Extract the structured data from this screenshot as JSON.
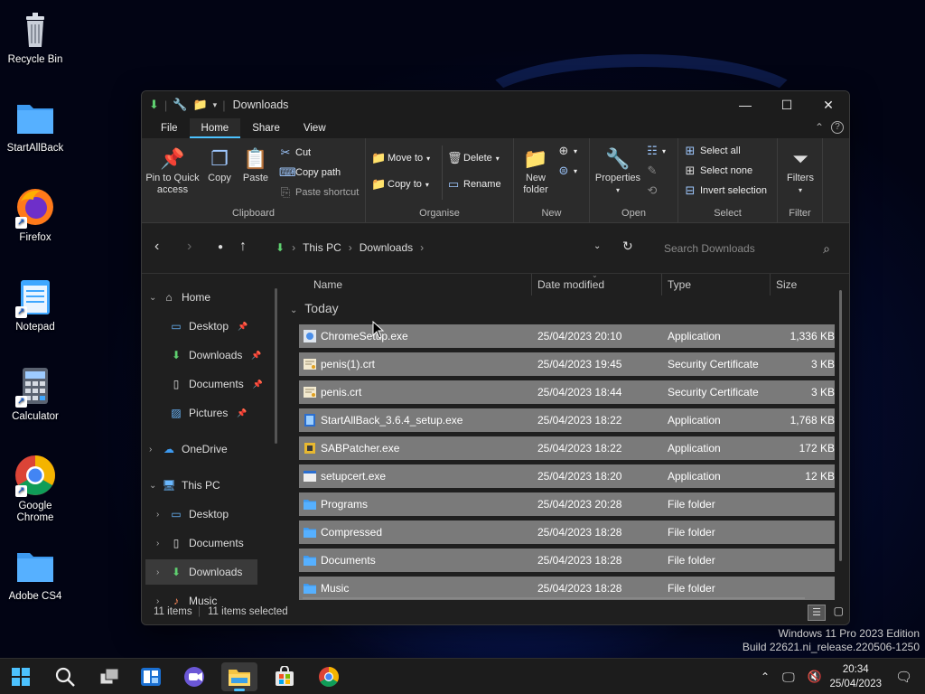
{
  "desktop_icons": [
    {
      "label": "Recycle Bin",
      "icon": "recycle-bin-icon"
    },
    {
      "label": "StartAllBack",
      "icon": "folder-icon"
    },
    {
      "label": "Firefox",
      "icon": "firefox-icon"
    },
    {
      "label": "Notepad",
      "icon": "notepad-icon"
    },
    {
      "label": "Calculator",
      "icon": "calculator-icon"
    },
    {
      "label": "Google Chrome",
      "icon": "chrome-icon"
    },
    {
      "label": "Adobe CS4",
      "icon": "folder-icon"
    }
  ],
  "window": {
    "title": "Downloads",
    "menu_tabs": [
      "File",
      "Home",
      "Share",
      "View"
    ],
    "active_tab": "Home",
    "ribbon": {
      "clipboard": {
        "name": "Clipboard",
        "pin_label": "Pin to Quick access",
        "copy_label": "Copy",
        "paste_label": "Paste",
        "cut_label": "Cut",
        "copy_path_label": "Copy path",
        "paste_shortcut_label": "Paste shortcut"
      },
      "organise": {
        "name": "Organise",
        "move_to_label": "Move to",
        "copy_to_label": "Copy to",
        "delete_label": "Delete",
        "rename_label": "Rename"
      },
      "new": {
        "name": "New",
        "new_folder_label": "New folder"
      },
      "open": {
        "name": "Open",
        "properties_label": "Properties"
      },
      "select": {
        "name": "Select",
        "select_all_label": "Select all",
        "select_none_label": "Select none",
        "invert_label": "Invert selection"
      },
      "filter": {
        "name": "Filter",
        "filters_label": "Filters"
      }
    },
    "address": {
      "crumbs": [
        "This PC",
        "Downloads"
      ],
      "search_placeholder": "Search Downloads"
    },
    "nav_pane": [
      {
        "label": "Home",
        "level": 0,
        "expanded": true
      },
      {
        "label": "Desktop",
        "level": 1,
        "pinned": true
      },
      {
        "label": "Downloads",
        "level": 1,
        "pinned": true
      },
      {
        "label": "Documents",
        "level": 1,
        "pinned": true
      },
      {
        "label": "Pictures",
        "level": 1,
        "pinned": true
      },
      {
        "label": "OneDrive",
        "level": 0,
        "expanded": false
      },
      {
        "label": "This PC",
        "level": 0,
        "expanded": true
      },
      {
        "label": "Desktop",
        "level": 1
      },
      {
        "label": "Documents",
        "level": 1
      },
      {
        "label": "Downloads",
        "level": 1,
        "selected": true
      },
      {
        "label": "Music",
        "level": 1
      }
    ],
    "columns": {
      "name": "Name",
      "date": "Date modified",
      "type": "Type",
      "size": "Size"
    },
    "group_label": "Today",
    "files": [
      {
        "name": "ChromeSetup.exe",
        "date": "25/04/2023 20:10",
        "type": "Application",
        "size": "1,336 KB",
        "icon": "setup-icon"
      },
      {
        "name": "penis(1).crt",
        "date": "25/04/2023 19:45",
        "type": "Security Certificate",
        "size": "3 KB",
        "icon": "certificate-icon"
      },
      {
        "name": "penis.crt",
        "date": "25/04/2023 18:44",
        "type": "Security Certificate",
        "size": "3 KB",
        "icon": "certificate-icon"
      },
      {
        "name": "StartAllBack_3.6.4_setup.exe",
        "date": "25/04/2023 18:22",
        "type": "Application",
        "size": "1,768 KB",
        "icon": "app-icon"
      },
      {
        "name": "SABPatcher.exe",
        "date": "25/04/2023 18:22",
        "type": "Application",
        "size": "172 KB",
        "icon": "patcher-icon"
      },
      {
        "name": "setupcert.exe",
        "date": "25/04/2023 18:20",
        "type": "Application",
        "size": "12 KB",
        "icon": "window-app-icon"
      },
      {
        "name": "Programs",
        "date": "25/04/2023 20:28",
        "type": "File folder",
        "size": "",
        "icon": "folder-icon"
      },
      {
        "name": "Compressed",
        "date": "25/04/2023 18:28",
        "type": "File folder",
        "size": "",
        "icon": "folder-icon"
      },
      {
        "name": "Documents",
        "date": "25/04/2023 18:28",
        "type": "File folder",
        "size": "",
        "icon": "folder-icon"
      },
      {
        "name": "Music",
        "date": "25/04/2023 18:28",
        "type": "File folder",
        "size": "",
        "icon": "folder-icon"
      }
    ],
    "status": {
      "count": "11 items",
      "selected": "11 items selected"
    }
  },
  "watermark": {
    "line1": "Windows 11 Pro 2023 Edition",
    "line2": "Build 22621.ni_release.220506-1250"
  },
  "clock": {
    "time": "20:34",
    "date": "25/04/2023"
  },
  "colors": {
    "accent": "#4cc2ff",
    "selection": "#7a7a7a",
    "folder": "#4aa8f0"
  }
}
